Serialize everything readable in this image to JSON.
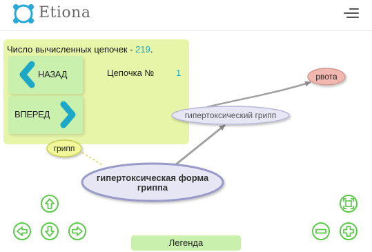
{
  "app": {
    "name": "Etiona"
  },
  "stats": {
    "prefix": "Число вычисленных цепочек - ",
    "count": "219",
    "suffix": "."
  },
  "nav": {
    "back_label": "НАЗАД",
    "forward_label": "ВПЕРЕД"
  },
  "chain": {
    "label": "Цепочка  №",
    "number": "1"
  },
  "graph": {
    "nodes": {
      "main": "гипертоксический грипп",
      "vomit": "рвота",
      "flu": "грипп",
      "form_line1": "гипертоксическая форма",
      "form_line2": "гриппа"
    }
  },
  "footer": {
    "legend_label": "Легенда"
  },
  "colors": {
    "accent": "#1ea8c8",
    "panel": "#e6f5a8",
    "card": "#c9f0ac",
    "control_green": "#5cc84a",
    "node_lavender": "#e6e6f5",
    "node_pink": "#f0b8b0",
    "node_yellow": "#f2f79a"
  },
  "icons": {
    "logo": "molecule-logo-icon",
    "menu": "hamburger-menu-icon",
    "back": "chevron-left-icon",
    "forward": "chevron-right-icon",
    "up": "arrow-up-icon",
    "down": "arrow-down-icon",
    "left": "arrow-left-icon",
    "right": "arrow-right-icon",
    "fit": "fit-screen-icon",
    "zoom_out": "zoom-out-icon",
    "zoom_in": "zoom-in-icon"
  }
}
